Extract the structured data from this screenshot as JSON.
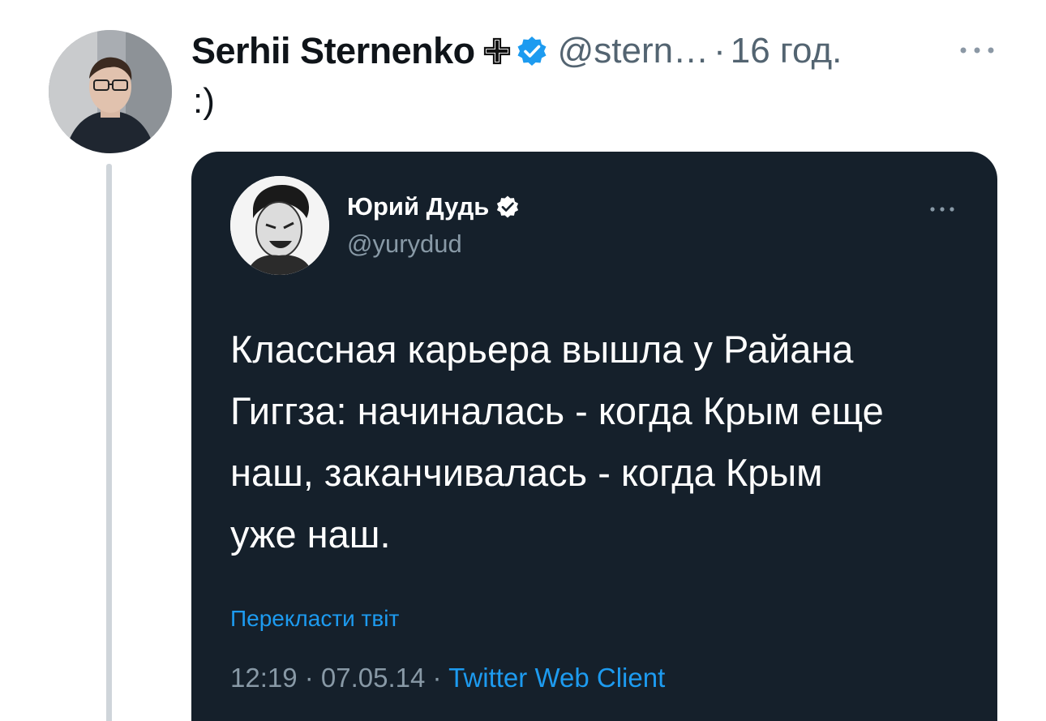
{
  "outer_tweet": {
    "author_name": "Serhii Sternenko",
    "handle": "@stern…",
    "separator": "·",
    "time": "16 год.",
    "text": ":)"
  },
  "quoted_tweet": {
    "author_name": "Юрий Дудь",
    "handle": "@yurydud",
    "text_lines": [
      "Классная карьера вышла у Райана",
      "Гиггза: начиналась - когда Крым еще",
      "наш, заканчивалась - когда Крым",
      "уже наш."
    ],
    "translate_label": "Перекласти твіт",
    "meta_time": "12:19 · 07.05.14 · ",
    "meta_source": "Twitter Web Client"
  },
  "colors": {
    "verified_blue": "#1d9bf0",
    "dark_card_bg": "#15202b",
    "secondary_text": "#536471",
    "link": "#1d9bf0"
  },
  "icons": {
    "outer_more": "more-horizontal-icon",
    "cross": "cross-emoji-icon",
    "verified": "verified-badge-icon"
  }
}
